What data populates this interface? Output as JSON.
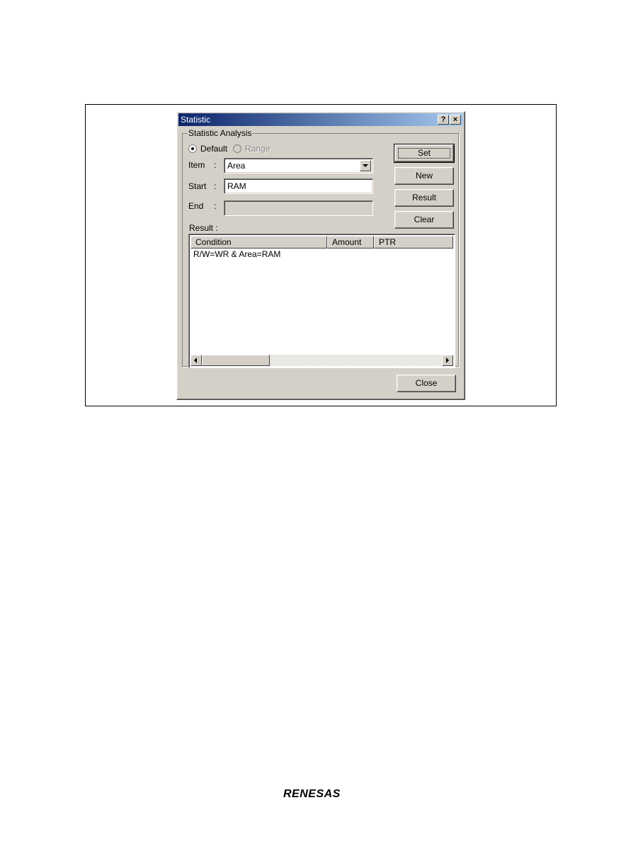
{
  "dialog": {
    "title": "Statistic",
    "help_button": "?",
    "close_x": "×",
    "group_title": "Statistic Analysis",
    "radio_default": "Default",
    "radio_range": "Range",
    "item_label": "Item",
    "item_value": "Area",
    "start_label": "Start",
    "start_value": "RAM",
    "end_label": "End",
    "end_value": "",
    "colon": ":",
    "buttons": {
      "set": "Set",
      "new": "New",
      "result": "Result",
      "clear": "Clear",
      "close": "Close"
    },
    "result_label": "Result :",
    "columns": [
      "Condition",
      "Amount",
      "PTR"
    ],
    "rows": [
      {
        "condition": "R/W=WR & Area=RAM",
        "amount": "",
        "ptr": ""
      }
    ]
  },
  "footer": {
    "logo": "RENESAS"
  },
  "colors": {
    "titlebar_start": "#0a246a",
    "titlebar_end": "#a6caf0",
    "dialog_face": "#d4d0c8"
  }
}
